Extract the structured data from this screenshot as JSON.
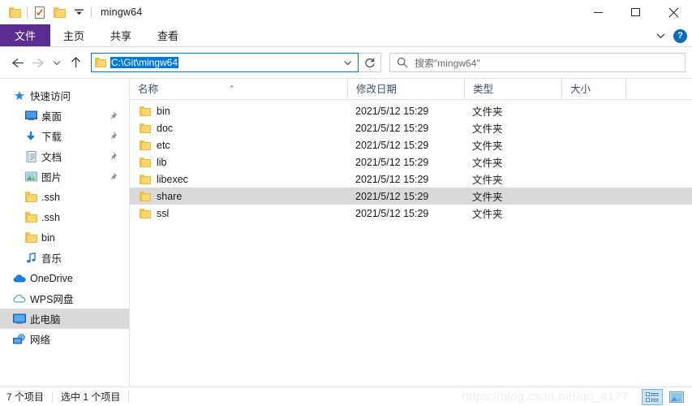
{
  "window": {
    "title": "mingw64",
    "quick_access": [
      {
        "name": "folder-icon",
        "label": "属性"
      },
      {
        "name": "properties-icon",
        "label": "属性"
      },
      {
        "name": "new-folder-icon",
        "label": "新建文件夹"
      },
      {
        "name": "customize-chevron-icon",
        "label": "自定义快速访问工具栏"
      }
    ],
    "controls": {
      "minimize": "—",
      "maximize": "□",
      "close": "✕"
    }
  },
  "ribbon": {
    "tabs": [
      {
        "label": "文件",
        "active": true
      },
      {
        "label": "主页",
        "active": false
      },
      {
        "label": "共享",
        "active": false
      },
      {
        "label": "查看",
        "active": false
      }
    ],
    "expand_label": "⌄",
    "help_label": "?"
  },
  "nav": {
    "back_label": "←",
    "forward_label": "→",
    "recent_label": "⌄",
    "up_label": "↑",
    "address": {
      "value": "C:\\Git\\mingw64",
      "selected": true,
      "dropdown_label": "⌄"
    },
    "refresh_label": "↻",
    "search": {
      "placeholder": "搜索\"mingw64\"",
      "icon": "search-icon"
    }
  },
  "sidebar": {
    "items": [
      {
        "label": "快速访问",
        "icon": "star-icon",
        "indent": false,
        "pinned": false,
        "selected": false
      },
      {
        "label": "桌面",
        "icon": "desktop-icon",
        "indent": true,
        "pinned": true,
        "selected": false
      },
      {
        "label": "下载",
        "icon": "download-icon",
        "indent": true,
        "pinned": true,
        "selected": false
      },
      {
        "label": "文档",
        "icon": "documents-icon",
        "indent": true,
        "pinned": true,
        "selected": false
      },
      {
        "label": "图片",
        "icon": "pictures-icon",
        "indent": true,
        "pinned": true,
        "selected": false
      },
      {
        "label": ".ssh",
        "icon": "folder-icon",
        "indent": true,
        "pinned": false,
        "selected": false
      },
      {
        "label": ".ssh",
        "icon": "folder-icon",
        "indent": true,
        "pinned": false,
        "selected": false
      },
      {
        "label": "bin",
        "icon": "folder-icon",
        "indent": true,
        "pinned": false,
        "selected": false
      },
      {
        "label": "音乐",
        "icon": "music-icon",
        "indent": true,
        "pinned": false,
        "selected": false
      },
      {
        "label": "OneDrive",
        "icon": "onedrive-icon",
        "indent": false,
        "pinned": false,
        "selected": false
      },
      {
        "label": "WPS网盘",
        "icon": "wps-cloud-icon",
        "indent": false,
        "pinned": false,
        "selected": false
      },
      {
        "label": "此电脑",
        "icon": "this-pc-icon",
        "indent": false,
        "pinned": false,
        "selected": true
      },
      {
        "label": "网络",
        "icon": "network-icon",
        "indent": false,
        "pinned": false,
        "selected": false
      }
    ]
  },
  "filelist": {
    "columns": [
      {
        "label": "名称",
        "sort": "asc"
      },
      {
        "label": "修改日期",
        "sort": null
      },
      {
        "label": "类型",
        "sort": null
      },
      {
        "label": "大小",
        "sort": null
      }
    ],
    "sort_caret": "⌃",
    "rows": [
      {
        "name": "bin",
        "date": "2021/5/12 15:29",
        "type": "文件夹",
        "size": "",
        "selected": false
      },
      {
        "name": "doc",
        "date": "2021/5/12 15:29",
        "type": "文件夹",
        "size": "",
        "selected": false
      },
      {
        "name": "etc",
        "date": "2021/5/12 15:29",
        "type": "文件夹",
        "size": "",
        "selected": false
      },
      {
        "name": "lib",
        "date": "2021/5/12 15:29",
        "type": "文件夹",
        "size": "",
        "selected": false
      },
      {
        "name": "libexec",
        "date": "2021/5/12 15:29",
        "type": "文件夹",
        "size": "",
        "selected": false
      },
      {
        "name": "share",
        "date": "2021/5/12 15:29",
        "type": "文件夹",
        "size": "",
        "selected": true
      },
      {
        "name": "ssl",
        "date": "2021/5/12 15:29",
        "type": "文件夹",
        "size": "",
        "selected": false
      }
    ]
  },
  "status": {
    "item_count": "7 个项目",
    "selection": "选中 1 个项目",
    "watermark": "https://blog.csdn.net/qq_4177",
    "view_details_label": "详细信息",
    "view_large_label": "大图标"
  },
  "colors": {
    "accent_purple": "#5c2d91",
    "accent_blue": "#0078d7",
    "selection_gray": "#d9d9d9",
    "folder_yellow": "#fcd670",
    "header_text": "#39506b"
  }
}
